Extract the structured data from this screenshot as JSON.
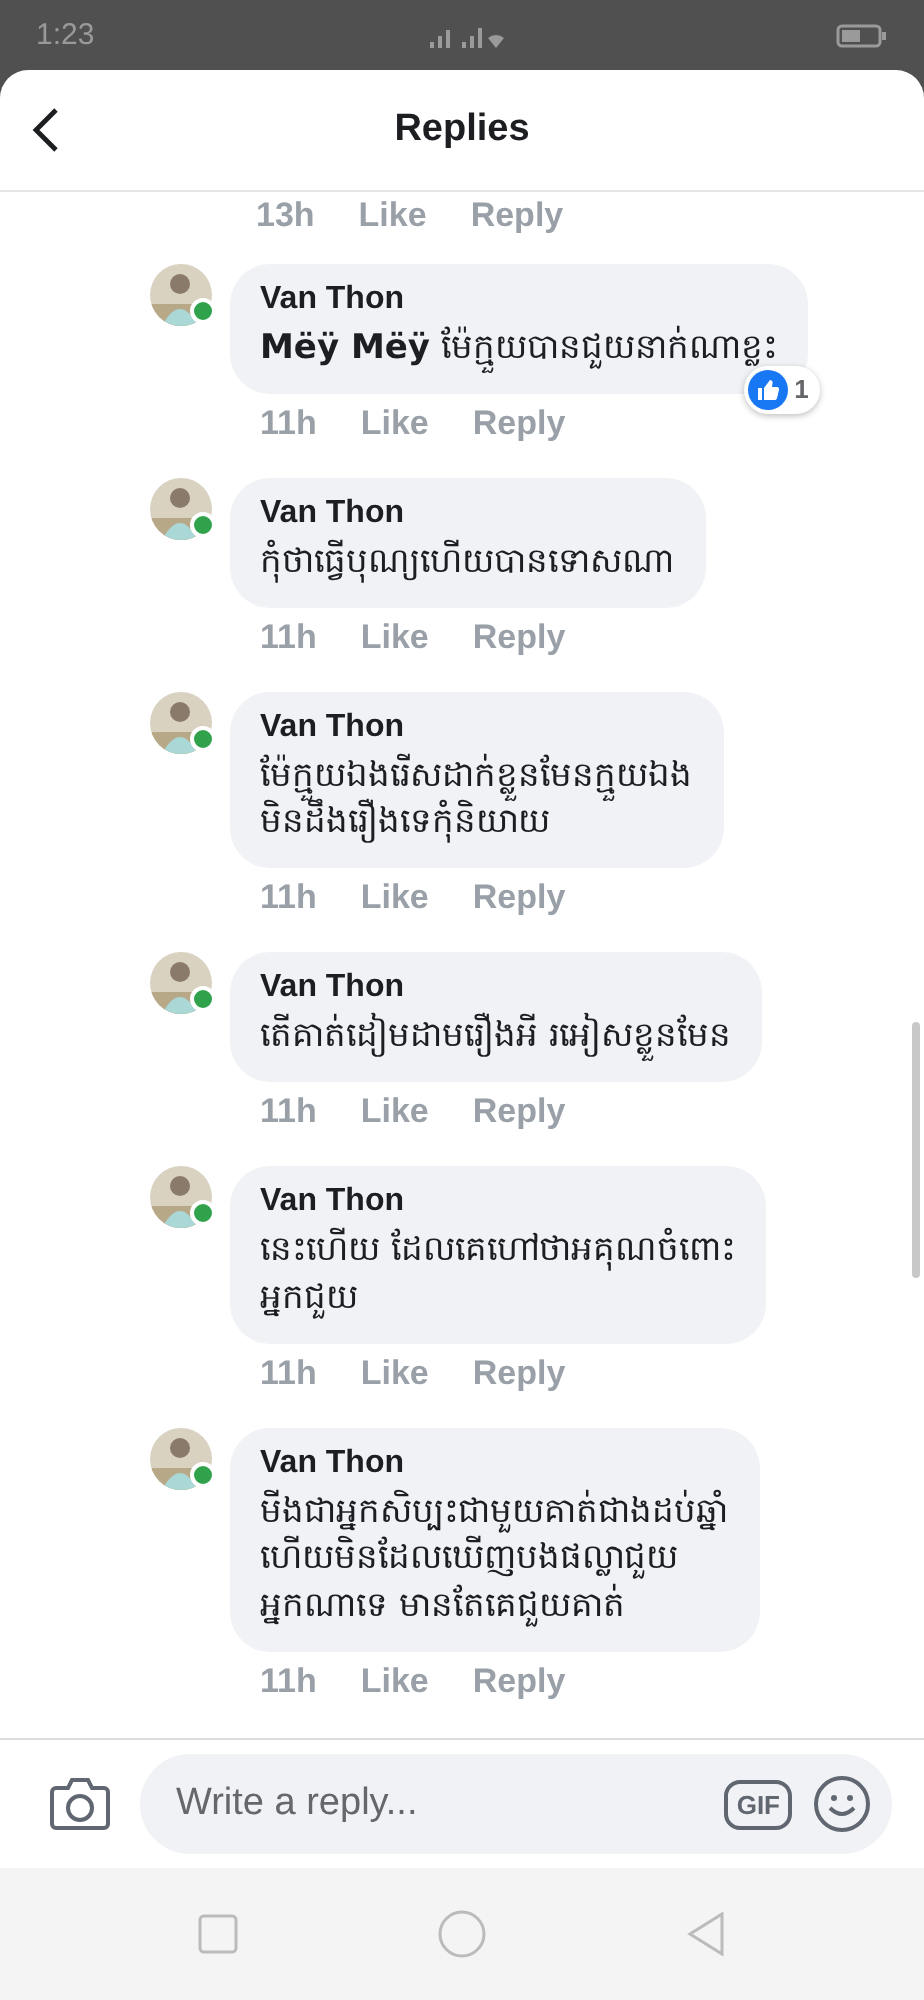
{
  "status_bar": {
    "time": "1:23"
  },
  "header": {
    "title": "Replies"
  },
  "previous_meta": {
    "time": "13h",
    "like": "Like",
    "reply": "Reply"
  },
  "comments": [
    {
      "author": "Van Thon",
      "text": "**Mëÿ Mëÿ**  ម៉ែក្មួយបានជួយនាក់ណាខ្លះ",
      "time": "11h",
      "like": "Like",
      "reply": "Reply",
      "online": true,
      "reactions": {
        "count": "1"
      }
    },
    {
      "author": "Van Thon",
      "text": "កុំថាធ្វើបុណ្យហើយបានទោសណា",
      "time": "11h",
      "like": "Like",
      "reply": "Reply",
      "online": true
    },
    {
      "author": "Van Thon",
      "text": "ម៉ែក្មួយឯងរើសដាក់ខ្លួនមែនក្មួយឯង\nមិនដឹងរឿងទេកុំនិយាយ",
      "time": "11h",
      "like": "Like",
      "reply": "Reply",
      "online": true
    },
    {
      "author": "Van Thon",
      "text": "តើគាត់ដៀមដាមរឿងអី រអៀសខ្លួនមែន",
      "time": "11h",
      "like": "Like",
      "reply": "Reply",
      "online": true
    },
    {
      "author": "Van Thon",
      "text": "នេះហើយ ដែលគេហៅថាអគុណចំពោះ\nអ្នកជួយ",
      "time": "11h",
      "like": "Like",
      "reply": "Reply",
      "online": true
    },
    {
      "author": "Van Thon",
      "text": "មីងជាអ្នកសិប្បះជាមួយគាត់ជាងដប់ឆ្នាំ\nហើយមិនដែលឃើញបងផល្លាជួយ\nអ្នកណាទេ មានតែគេជួយគាត់",
      "time": "11h",
      "like": "Like",
      "reply": "Reply",
      "online": true
    }
  ],
  "composer": {
    "placeholder": "Write a reply...",
    "gif": "GIF"
  }
}
